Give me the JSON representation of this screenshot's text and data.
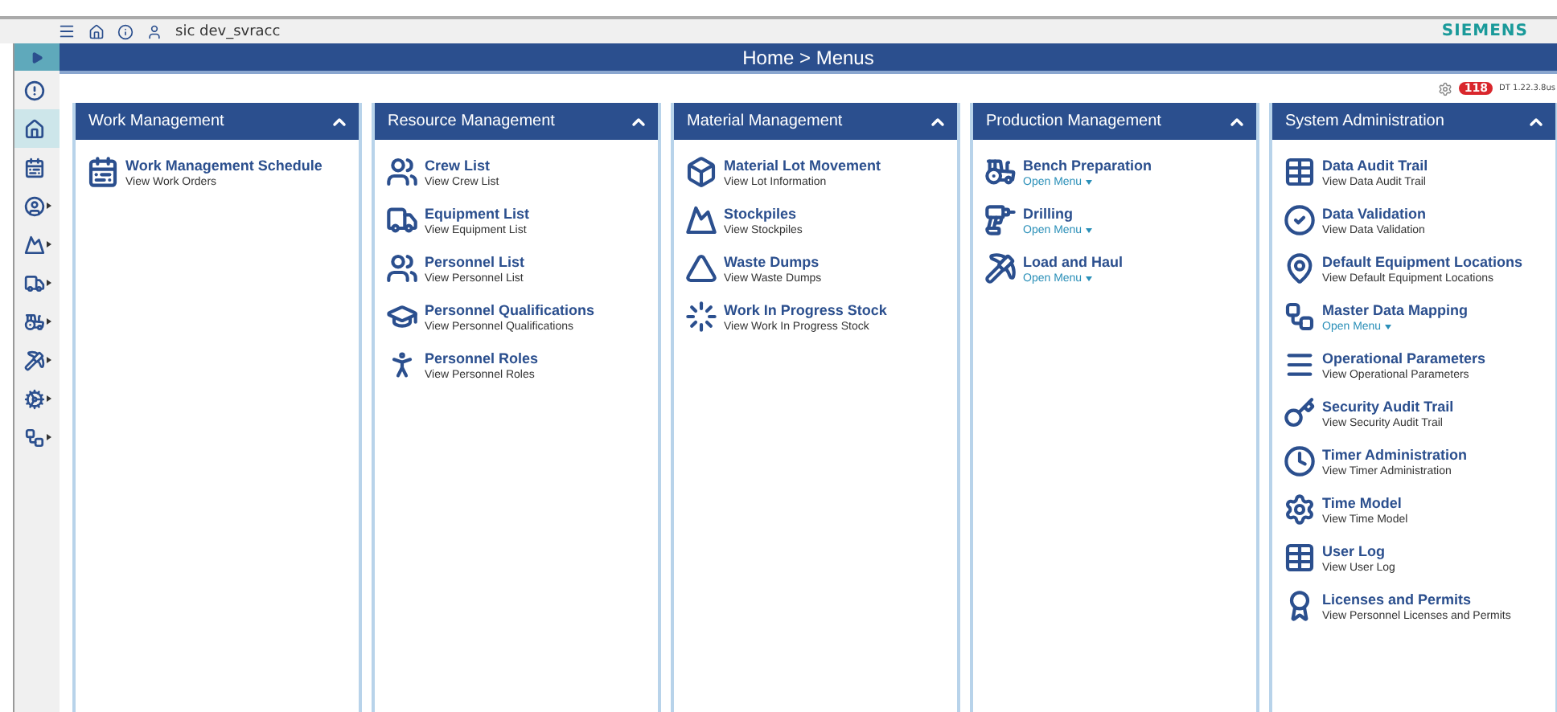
{
  "top_bar": {
    "user": "sic dev_svracc",
    "brand": "SIEMENS"
  },
  "breadcrumb": "Home >  Menus",
  "status": {
    "badge": "118",
    "version": "DT 1.22.3.8us"
  },
  "sidebar_open": false,
  "sidebar": [
    {
      "selected": false,
      "submenu": false
    },
    {
      "selected": true,
      "submenu": false
    },
    {
      "selected": false,
      "submenu": false
    },
    {
      "selected": false,
      "submenu": true
    },
    {
      "selected": false,
      "submenu": true
    },
    {
      "selected": false,
      "submenu": true
    },
    {
      "selected": false,
      "submenu": true
    },
    {
      "selected": false,
      "submenu": true
    },
    {
      "selected": false,
      "submenu": true
    },
    {
      "selected": false,
      "submenu": true
    }
  ],
  "sections": [
    {
      "title": "Work Management",
      "expanded": true,
      "items": [
        {
          "kind": "link",
          "title": "Work Management Schedule",
          "subtitle": "View Work Orders"
        }
      ]
    },
    {
      "title": "Resource Management",
      "expanded": true,
      "items": [
        {
          "kind": "link",
          "title": "Crew List",
          "subtitle": "View Crew List"
        },
        {
          "kind": "link",
          "title": "Equipment List",
          "subtitle": "View Equipment List"
        },
        {
          "kind": "link",
          "title": "Personnel List",
          "subtitle": "View Personnel List"
        },
        {
          "kind": "link",
          "title": "Personnel Qualifications",
          "subtitle": "View Personnel Qualifications"
        },
        {
          "kind": "link",
          "title": "Personnel Roles",
          "subtitle": "View Personnel Roles"
        }
      ]
    },
    {
      "title": "Material Management",
      "expanded": true,
      "items": [
        {
          "kind": "link",
          "title": "Material Lot Movement",
          "subtitle": "View Lot Information"
        },
        {
          "kind": "link",
          "title": "Stockpiles",
          "subtitle": "View Stockpiles"
        },
        {
          "kind": "link",
          "title": "Waste Dumps",
          "subtitle": "View Waste Dumps"
        },
        {
          "kind": "link",
          "title": "Work In Progress Stock",
          "subtitle": "View Work In Progress Stock"
        }
      ]
    },
    {
      "title": "Production Management",
      "expanded": true,
      "items": [
        {
          "kind": "menu",
          "title": "Bench Preparation",
          "subtitle": "Open Menu"
        },
        {
          "kind": "menu",
          "title": "Drilling",
          "subtitle": "Open Menu"
        },
        {
          "kind": "menu",
          "title": "Load and Haul",
          "subtitle": "Open Menu"
        }
      ]
    },
    {
      "title": "System Administration",
      "expanded": true,
      "items": [
        {
          "kind": "link",
          "title": "Data Audit Trail",
          "subtitle": "View Data Audit Trail"
        },
        {
          "kind": "link",
          "title": "Data Validation",
          "subtitle": "View Data Validation"
        },
        {
          "kind": "link",
          "title": "Default Equipment Locations",
          "subtitle": "View Default Equipment Locations"
        },
        {
          "kind": "menu",
          "title": "Master Data Mapping",
          "subtitle": "Open Menu"
        },
        {
          "kind": "link",
          "title": "Operational Parameters",
          "subtitle": "View Operational Parameters"
        },
        {
          "kind": "link",
          "title": "Security Audit Trail",
          "subtitle": "View Security Audit Trail"
        },
        {
          "kind": "link",
          "title": "Timer Administration",
          "subtitle": "View Timer Administration"
        },
        {
          "kind": "link",
          "title": "Time Model",
          "subtitle": "View Time Model"
        },
        {
          "kind": "link",
          "title": "User Log",
          "subtitle": "View User Log"
        },
        {
          "kind": "link",
          "title": "Licenses and Permits",
          "subtitle": "View Personnel Licenses and Permits"
        }
      ]
    }
  ]
}
